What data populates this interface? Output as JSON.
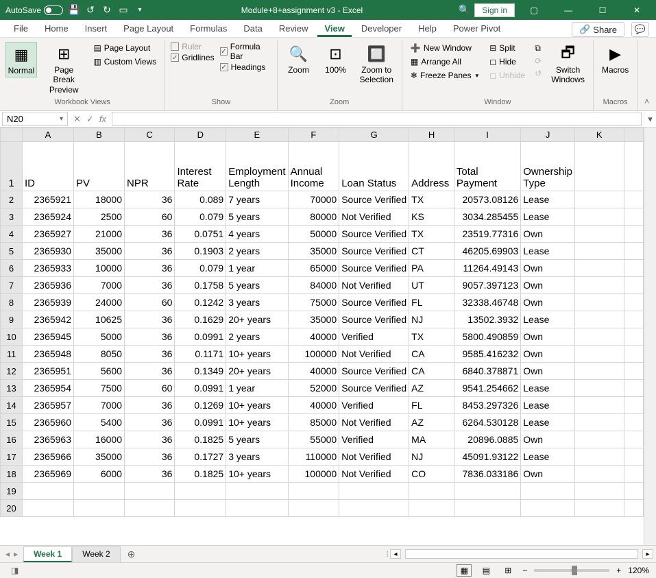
{
  "title_bar": {
    "autosave_label": "AutoSave",
    "autosave_state": "Off",
    "doc_title": "Module+8+assignment v3  -  Excel",
    "signin": "Sign in"
  },
  "menu_tabs": [
    "File",
    "Home",
    "Insert",
    "Page Layout",
    "Formulas",
    "Data",
    "Review",
    "View",
    "Developer",
    "Help",
    "Power Pivot"
  ],
  "active_tab": "View",
  "share_label": "Share",
  "ribbon": {
    "views": {
      "normal": "Normal",
      "pagebreak": "Page Break\nPreview",
      "pagelayout": "Page Layout",
      "customviews": "Custom Views",
      "group": "Workbook Views"
    },
    "show": {
      "ruler": "Ruler",
      "gridlines": "Gridlines",
      "formulabar": "Formula Bar",
      "headings": "Headings",
      "group": "Show"
    },
    "zoom": {
      "zoom": "Zoom",
      "hundred": "100%",
      "zts": "Zoom to\nSelection",
      "group": "Zoom"
    },
    "window": {
      "neww": "New Window",
      "arrange": "Arrange All",
      "freeze": "Freeze Panes",
      "split": "Split",
      "hide": "Hide",
      "unhide": "Unhide",
      "switch": "Switch\nWindows",
      "group": "Window"
    },
    "macros": {
      "macros": "Macros",
      "group": "Macros"
    }
  },
  "namebox": "N20",
  "columns": [
    "A",
    "B",
    "C",
    "D",
    "E",
    "F",
    "G",
    "H",
    "I",
    "J",
    "K"
  ],
  "headers": {
    "A": "ID",
    "B": "PV",
    "C": "NPR",
    "D": "Interest Rate",
    "E": "Employment Length",
    "F": "Annual Income",
    "G": "Loan Status",
    "H": "Address",
    "I": "Total Payment",
    "J": "Ownership Type",
    "K": ""
  },
  "rows": [
    {
      "r": 2,
      "A": "2365921",
      "B": "18000",
      "C": "36",
      "D": "0.089",
      "E": "7 years",
      "F": "70000",
      "G": "Source Verified",
      "H": "TX",
      "I": "20573.08126",
      "J": "Lease"
    },
    {
      "r": 3,
      "A": "2365924",
      "B": "2500",
      "C": "60",
      "D": "0.079",
      "E": "5 years",
      "F": "80000",
      "G": "Not Verified",
      "H": "KS",
      "I": "3034.285455",
      "J": "Lease"
    },
    {
      "r": 4,
      "A": "2365927",
      "B": "21000",
      "C": "36",
      "D": "0.0751",
      "E": "4 years",
      "F": "50000",
      "G": "Source Verified",
      "H": "TX",
      "I": "23519.77316",
      "J": "Own"
    },
    {
      "r": 5,
      "A": "2365930",
      "B": "35000",
      "C": "36",
      "D": "0.1903",
      "E": "2 years",
      "F": "35000",
      "G": "Source Verified",
      "H": "CT",
      "I": "46205.69903",
      "J": "Lease"
    },
    {
      "r": 6,
      "A": "2365933",
      "B": "10000",
      "C": "36",
      "D": "0.079",
      "E": "1 year",
      "F": "65000",
      "G": "Source Verified",
      "H": "PA",
      "I": "11264.49143",
      "J": "Own"
    },
    {
      "r": 7,
      "A": "2365936",
      "B": "7000",
      "C": "36",
      "D": "0.1758",
      "E": "5 years",
      "F": "84000",
      "G": "Not Verified",
      "H": "UT",
      "I": "9057.397123",
      "J": "Own"
    },
    {
      "r": 8,
      "A": "2365939",
      "B": "24000",
      "C": "60",
      "D": "0.1242",
      "E": "3 years",
      "F": "75000",
      "G": "Source Verified",
      "H": "FL",
      "I": "32338.46748",
      "J": "Own"
    },
    {
      "r": 9,
      "A": "2365942",
      "B": "10625",
      "C": "36",
      "D": "0.1629",
      "E": "20+ years",
      "F": "35000",
      "G": "Source Verified",
      "H": "NJ",
      "I": "13502.3932",
      "J": "Lease"
    },
    {
      "r": 10,
      "A": "2365945",
      "B": "5000",
      "C": "36",
      "D": "0.0991",
      "E": "2 years",
      "F": "40000",
      "G": "Verified",
      "H": "TX",
      "I": "5800.490859",
      "J": "Own"
    },
    {
      "r": 11,
      "A": "2365948",
      "B": "8050",
      "C": "36",
      "D": "0.1171",
      "E": "10+ years",
      "F": "100000",
      "G": "Not Verified",
      "H": "CA",
      "I": "9585.416232",
      "J": "Own"
    },
    {
      "r": 12,
      "A": "2365951",
      "B": "5600",
      "C": "36",
      "D": "0.1349",
      "E": "20+ years",
      "F": "40000",
      "G": "Source Verified",
      "H": "CA",
      "I": "6840.378871",
      "J": "Own"
    },
    {
      "r": 13,
      "A": "2365954",
      "B": "7500",
      "C": "60",
      "D": "0.0991",
      "E": "1 year",
      "F": "52000",
      "G": "Source Verified",
      "H": "AZ",
      "I": "9541.254662",
      "J": "Lease"
    },
    {
      "r": 14,
      "A": "2365957",
      "B": "7000",
      "C": "36",
      "D": "0.1269",
      "E": "10+ years",
      "F": "40000",
      "G": "Verified",
      "H": "FL",
      "I": "8453.297326",
      "J": "Lease"
    },
    {
      "r": 15,
      "A": "2365960",
      "B": "5400",
      "C": "36",
      "D": "0.0991",
      "E": "10+ years",
      "F": "85000",
      "G": "Not Verified",
      "H": "AZ",
      "I": "6264.530128",
      "J": "Lease"
    },
    {
      "r": 16,
      "A": "2365963",
      "B": "16000",
      "C": "36",
      "D": "0.1825",
      "E": "5 years",
      "F": "55000",
      "G": "Verified",
      "H": "MA",
      "I": "20896.0885",
      "J": "Own"
    },
    {
      "r": 17,
      "A": "2365966",
      "B": "35000",
      "C": "36",
      "D": "0.1727",
      "E": "3 years",
      "F": "110000",
      "G": "Not Verified",
      "H": "NJ",
      "I": "45091.93122",
      "J": "Lease"
    },
    {
      "r": 18,
      "A": "2365969",
      "B": "6000",
      "C": "36",
      "D": "0.1825",
      "E": "10+ years",
      "F": "100000",
      "G": "Not Verified",
      "H": "CO",
      "I": "7836.033186",
      "J": "Own"
    }
  ],
  "empty_rows": [
    19,
    20
  ],
  "selected_cell": {
    "row": 20,
    "col": "N"
  },
  "sheets": {
    "tabs": [
      "Week 1",
      "Week 2"
    ],
    "active": "Week 1"
  },
  "zoom_label": "120%",
  "numeric_cols": [
    "A",
    "B",
    "C",
    "D",
    "F",
    "I"
  ],
  "text_cols": [
    "E",
    "G",
    "H",
    "J",
    "K"
  ]
}
